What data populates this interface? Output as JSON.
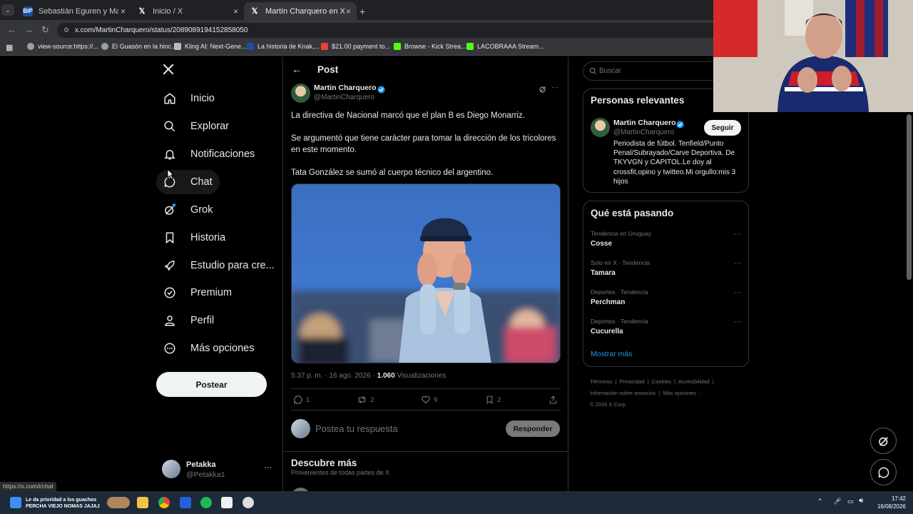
{
  "browser": {
    "tabs": [
      {
        "title": "Sebastián Eguren y Martín Ligü",
        "close": "×"
      },
      {
        "title": "Inicio / X",
        "close": "×"
      },
      {
        "title": "Martín Charquero en X: \"La dir",
        "close": "×"
      }
    ],
    "new_tab": "+",
    "url": "x.com/MartinCharquero/status/2089089194152858050",
    "bookmarks": [
      "view-source:https://...",
      "El Guasón en la hinc...",
      "Kling AI: Next-Gene...",
      "La historia de Knak,...",
      "$21.00 payment to...",
      "Browse - Kick Strea...",
      "LACOBRAAA Stream..."
    ],
    "status_url": "https://x.com/i/chat"
  },
  "nav": {
    "items": [
      {
        "label": "Inicio",
        "icon": "home-icon"
      },
      {
        "label": "Explorar",
        "icon": "search-icon"
      },
      {
        "label": "Notificaciones",
        "icon": "bell-icon"
      },
      {
        "label": "Chat",
        "icon": "chat-icon"
      },
      {
        "label": "Grok",
        "icon": "grok-icon"
      },
      {
        "label": "Historia",
        "icon": "bookmark-icon"
      },
      {
        "label": "Estudio para cre...",
        "icon": "rocket-icon"
      },
      {
        "label": "Premium",
        "icon": "verified-icon"
      },
      {
        "label": "Perfil",
        "icon": "person-icon"
      },
      {
        "label": "Más opciones",
        "icon": "more-circle-icon"
      }
    ],
    "post_button": "Postear",
    "account": {
      "name": "Petakka",
      "handle": "@Petakka1",
      "more": "···"
    }
  },
  "post": {
    "header": "Post",
    "author_name": "Martin Charquero",
    "author_handle": "@MartinCharquero",
    "more": "···",
    "paragraphs": [
      "La directiva de Nacional marcó que el plan B es Diego Monarriz.",
      "Se argumentó que tiene carácter para tomar la dirección de los tricolores en este momento.",
      "Tata González se sumó al cuerpo técnico del argentino."
    ],
    "timestamp": "5:37 p. m. · 16 ago. 2026 ·",
    "views_count": "1.060",
    "views_label": "Visualizaciones",
    "actions": {
      "replies": "1",
      "reposts": "2",
      "likes": "9",
      "bookmarks": "2"
    },
    "reply_placeholder": "Postea tu respuesta",
    "reply_button": "Responder"
  },
  "discover": {
    "title": "Descubre más",
    "subtitle": "Provenientes de todas partes de X"
  },
  "right": {
    "search_placeholder": "Buscar",
    "relevant_title": "Personas relevantes",
    "relevant_person": {
      "name": "Martin Charquero",
      "handle": "@MartinCharquero",
      "follow": "Seguir",
      "bio": "Periodista de fútbol. Tenfield/Punto Penal/Subrayado/Carve Deportiva. De TKYVGN y CAPITOL.Le doy al crossfit,opino y twitteo.Mi orgullo:mis 3 hijos"
    },
    "trending_title": "Qué está pasando",
    "trends": [
      {
        "meta": "Tendencia en Uruguay",
        "name": "Cosse"
      },
      {
        "meta": "Solo en X · Tendencia",
        "name": "Tamara"
      },
      {
        "meta": "Deportes · Tendencia",
        "name": "Perchman"
      },
      {
        "meta": "Deportes · Tendencia",
        "name": "Cucurella"
      }
    ],
    "show_more": "Mostrar más",
    "footer_line1": [
      "Términos",
      "Privacidad",
      "Cookies",
      "Accesibilidad"
    ],
    "footer_line2": [
      "Información sobre anuncios",
      "Más opciones ···"
    ],
    "copyright": "© 2026 X Corp."
  },
  "taskbar": {
    "notification_line1": "Le da prioridad a los guachos",
    "notification_line2": "PERCHA VIEJO NOMAS JAJAJ",
    "time": "17:42",
    "date": "16/08/2026"
  },
  "colors": {
    "accent": "#1d9bf0",
    "bg": "#000000",
    "border": "#2f3336",
    "muted": "#71767b"
  }
}
